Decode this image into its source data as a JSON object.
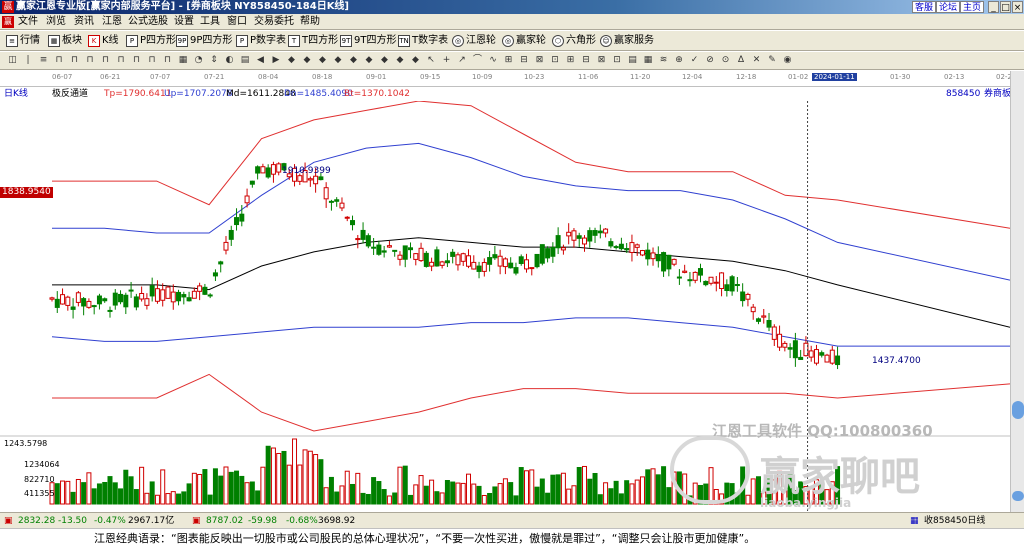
{
  "window": {
    "title": "赢家江恩专业版[赢家内部服务平台] - [券商板块  NY858450-184日K线]",
    "links": [
      "客服",
      "论坛",
      "主页"
    ],
    "controls": [
      "_",
      "□",
      "×"
    ]
  },
  "menu": [
    "文件",
    "浏览",
    "资讯",
    "江恩",
    "公式选股",
    "设置",
    "工具",
    "窗口",
    "交易委托",
    "帮助"
  ],
  "toolbar": [
    {
      "icon": "list-icon",
      "label": "行情"
    },
    {
      "icon": "grid-icon",
      "label": "板块"
    },
    {
      "icon": "kline-icon",
      "label": "K线"
    },
    {
      "icon": "p-icon",
      "label": "P四方形"
    },
    {
      "icon": "9p-icon",
      "label": "9P四方形"
    },
    {
      "icon": "p-icon",
      "label": "P数字表"
    },
    {
      "icon": "t-icon",
      "label": "T四方形"
    },
    {
      "icon": "9t-icon",
      "label": "9T四方形"
    },
    {
      "icon": "tn-icon",
      "label": "T数字表"
    },
    {
      "icon": "wheel-icon",
      "label": "江恩轮"
    },
    {
      "icon": "wheel-icon",
      "label": "赢家轮"
    },
    {
      "icon": "hexagon-icon",
      "label": "六角形"
    },
    {
      "icon": "service-icon",
      "label": "赢家服务"
    }
  ],
  "chart_header": {
    "period": "日K线",
    "indicator": "极反通道",
    "tp": "Tp=1790.6411",
    "up": "Up=1707.2078",
    "md": "Md=1611.2848",
    "dn": "Dn=1485.4090",
    "bt": "Bt=1370.1042",
    "code": "858450",
    "name": "券商板块"
  },
  "dates": [
    "06-07",
    "06-21",
    "07-07",
    "07-21",
    "08-04",
    "08-18",
    "09-01",
    "09-15",
    "10-09",
    "10-23",
    "11-06",
    "11-20",
    "12-04",
    "12-18",
    "01-02",
    "2024-01-11",
    "01-30",
    "02-13",
    "02-27"
  ],
  "annotations": {
    "high": "1910.9399",
    "low": "1437.4700",
    "price_tag": "1838.9540"
  },
  "volume_axis": [
    "1243.5798",
    "1234064",
    "822710",
    "411355"
  ],
  "watermark": {
    "line1": "江恩工具软件  QQ:100800360",
    "logo": "赢家聊吧",
    "url": "liaoba.yingjia"
  },
  "status": {
    "sh_value": "2832.28",
    "sh_change": "-13.50",
    "sh_pct": "-0.47%",
    "sh_amount": "2967.17亿",
    "sz_value": "8787.02",
    "sz_change": "-59.98",
    "sz_pct": "-0.68%",
    "sz_amount": "3698.92",
    "right": "收858450日线"
  },
  "quote": "江恩经典语录：“图表能反映出一切股市或公司股民的总体心理状况”，“不要一次性买进，傲慢就是罪过”，“调整只会让股市更加健康”。",
  "colors": {
    "up_candle": "#d00000",
    "down_candle": "#008000",
    "tp_line": "#e03030",
    "up_line": "#3040d0",
    "md_line": "#000000",
    "accent": "#0a246a"
  },
  "chart_data": {
    "type": "candlestick",
    "title": "券商板块 858450 日K线",
    "xlabel": "",
    "ylabel": "",
    "x": [
      "06-07",
      "06-21",
      "07-07",
      "07-21",
      "08-04",
      "08-18",
      "09-01",
      "09-15",
      "10-09",
      "10-23",
      "11-06",
      "11-20",
      "12-04",
      "12-18",
      "01-02",
      "01-11"
    ],
    "close": [
      1580,
      1570,
      1590,
      1600,
      1860,
      1840,
      1700,
      1670,
      1660,
      1650,
      1720,
      1700,
      1640,
      1610,
      1480,
      1450
    ],
    "ylim": [
      1300,
      2000
    ],
    "series": [
      {
        "name": "Tp",
        "values": [
          1830,
          1830,
          1830,
          1780,
          1920,
          1960,
          1980,
          2000,
          1990,
          1930,
          1870,
          1850,
          1850,
          1850,
          1800,
          1790
        ]
      },
      {
        "name": "Up",
        "values": [
          1730,
          1730,
          1720,
          1720,
          1800,
          1870,
          1900,
          1910,
          1880,
          1840,
          1820,
          1810,
          1810,
          1790,
          1750,
          1700
        ]
      },
      {
        "name": "Md",
        "values": [
          1610,
          1610,
          1610,
          1600,
          1650,
          1680,
          1700,
          1710,
          1700,
          1690,
          1690,
          1680,
          1670,
          1660,
          1640,
          1610
        ]
      },
      {
        "name": "Dn",
        "values": [
          1500,
          1490,
          1490,
          1500,
          1510,
          1520,
          1520,
          1520,
          1530,
          1530,
          1540,
          1540,
          1530,
          1520,
          1500,
          1480
        ]
      },
      {
        "name": "Bt",
        "values": [
          1370,
          1370,
          1370,
          1420,
          1340,
          1300,
          1320,
          1340,
          1370,
          1390,
          1390,
          1380,
          1380,
          1380,
          1380,
          1370
        ]
      }
    ]
  }
}
